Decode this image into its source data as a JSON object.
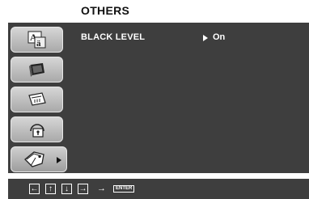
{
  "header": {
    "title": "OTHERS"
  },
  "sidebar": {
    "tabs": [
      {
        "icon": "language-icon",
        "active": false
      },
      {
        "icon": "tv-screen-icon",
        "active": false
      },
      {
        "icon": "display-settings-icon",
        "active": false
      },
      {
        "icon": "lock-icon",
        "active": false
      },
      {
        "icon": "others-tag-icon",
        "active": true
      }
    ]
  },
  "settings": {
    "rows": [
      {
        "label": "BLACK LEVEL",
        "value": "On"
      }
    ]
  },
  "navigation_bar": {
    "keys": [
      "←",
      "↑",
      "↓",
      "→"
    ],
    "arrow": "→",
    "enter_label": "ENTER"
  }
}
